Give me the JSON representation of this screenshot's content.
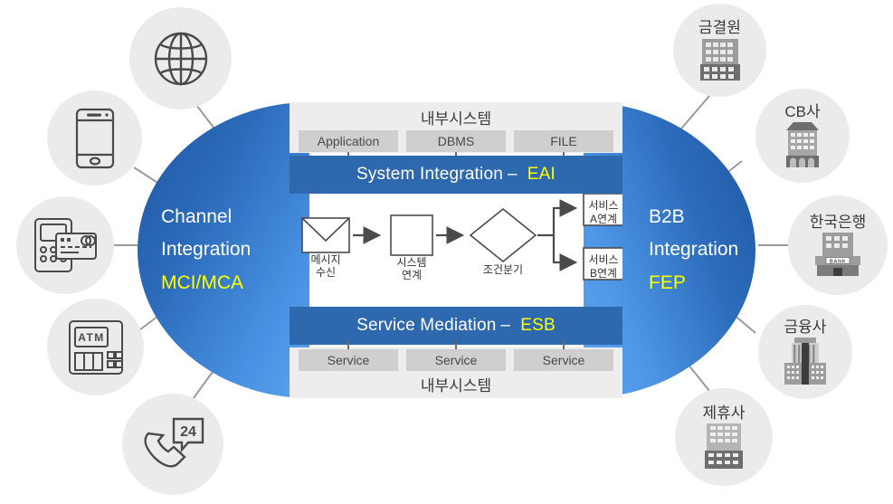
{
  "capsules": {
    "left": {
      "line1": "Channel",
      "line2": "Integration",
      "accent": "MCI/MCA"
    },
    "right": {
      "line1": "B2B",
      "line2": "Integration",
      "accent": "FEP"
    }
  },
  "bars": {
    "eai": {
      "label": "System Integration",
      "dash": "–",
      "accent": "EAI"
    },
    "esb": {
      "label": "Service Mediation",
      "dash": "–",
      "accent": "ESB"
    }
  },
  "panels": {
    "top": {
      "caption": "내부시스템",
      "chips": [
        "Application",
        "DBMS",
        "FILE"
      ]
    },
    "bottom": {
      "caption": "내부시스템",
      "chips": [
        "Service",
        "Service",
        "Service"
      ]
    }
  },
  "flow": {
    "steps": [
      {
        "icon": "envelope-icon",
        "label_line1": "메시지",
        "label_line2": "수신"
      },
      {
        "icon": "rectangle-icon",
        "label_line1": "시스템",
        "label_line2": "연계"
      },
      {
        "icon": "diamond-icon",
        "label_line1": "조건분기",
        "label_line2": ""
      }
    ],
    "branches": [
      {
        "line1": "서비스",
        "line2": "A연계"
      },
      {
        "line1": "서비스",
        "line2": "B연계"
      }
    ]
  },
  "channels": [
    {
      "icon": "globe-icon",
      "label": ""
    },
    {
      "icon": "smartphone-icon",
      "label": ""
    },
    {
      "icon": "card-terminal-icon",
      "label": ""
    },
    {
      "icon": "atm-icon",
      "label": ""
    },
    {
      "icon": "call-center-24-icon",
      "label": ""
    }
  ],
  "partners": [
    {
      "icon": "building-grid-icon",
      "label": "금결원"
    },
    {
      "icon": "office-tower-icon",
      "label": "CB사"
    },
    {
      "icon": "bank-icon",
      "label": "한국은행",
      "sign": "BANK"
    },
    {
      "icon": "skyscraper-icon",
      "label": "금융사"
    },
    {
      "icon": "building-grid-icon",
      "label": "제휴사"
    }
  ],
  "colors": {
    "bar_blue": "#2e68ae",
    "capsule_dark": "#1f56a0",
    "capsule_light": "#5ba3ed",
    "accent_yellow": "#ffff00",
    "panel_grey": "#ededed",
    "chip_grey": "#cfcfcf",
    "bubble_grey": "#ebebeb",
    "line_grey": "#9a9a9a"
  }
}
